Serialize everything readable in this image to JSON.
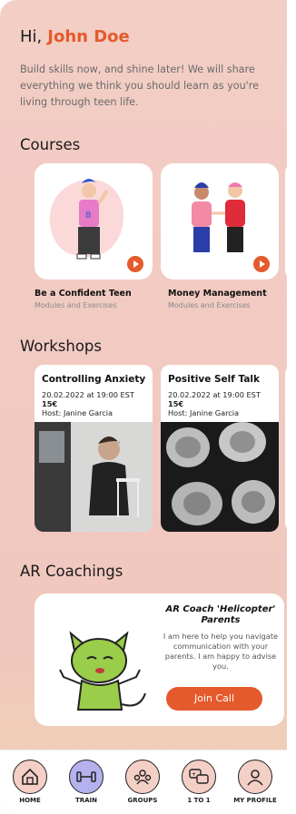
{
  "greeting": {
    "hi": "Hi,",
    "name": "John Doe"
  },
  "intro": "Build skills now, and shine later! We will share everything we think you should learn as you're living through teen life.",
  "courses": {
    "title": "Courses",
    "items": [
      {
        "title": "Be a Confident Teen",
        "subtitle": "Modules and Exercises"
      },
      {
        "title": "Money Management",
        "subtitle": "Modules and Exercises"
      }
    ]
  },
  "workshops": {
    "title": "Workshops",
    "items": [
      {
        "title": "Controlling Anxiety",
        "date": "20.02.2022 at 19:00 EST",
        "price": "15€",
        "host": "Host: Janine Garcia"
      },
      {
        "title": "Positive Self Talk",
        "date": "20.02.2022 at 19:00 EST",
        "price": "15€",
        "host": "Host: Janine Garcia"
      }
    ]
  },
  "coachings": {
    "title": "AR Coachings",
    "card": {
      "title": "AR Coach 'Helicopter' Parents",
      "text": "I am here to help you navigate communication with your parents. I am happy to advise you.",
      "button": "Join Call"
    }
  },
  "nav": [
    {
      "label": "HOME",
      "icon": "home-icon"
    },
    {
      "label": "TRAIN",
      "icon": "dumbbell-icon",
      "active": true
    },
    {
      "label": "GROUPS",
      "icon": "group-icon"
    },
    {
      "label": "1 TO 1",
      "icon": "chat-bubbles-icon"
    },
    {
      "label": "MY PROFILE",
      "icon": "person-icon"
    }
  ],
  "colors": {
    "accent": "#e55a2c",
    "active_nav": "#b5b1ee",
    "background": "#f2cec5"
  }
}
